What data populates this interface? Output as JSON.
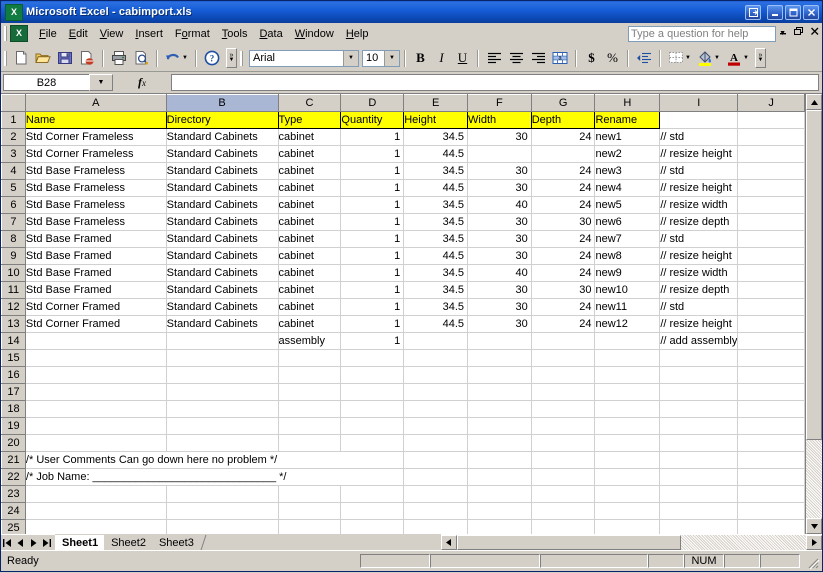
{
  "window": {
    "title": "Microsoft Excel - cabimport.xls",
    "app_icon": "excel-icon",
    "buttons": {
      "restore_group": "restore-window-group",
      "minimize": "minimize",
      "maximize": "maximize",
      "close": "close"
    }
  },
  "menu": {
    "items": [
      {
        "label": "File",
        "accel": "F"
      },
      {
        "label": "Edit",
        "accel": "E"
      },
      {
        "label": "View",
        "accel": "V"
      },
      {
        "label": "Insert",
        "accel": "I"
      },
      {
        "label": "Format",
        "accel": "o"
      },
      {
        "label": "Tools",
        "accel": "T"
      },
      {
        "label": "Data",
        "accel": "D"
      },
      {
        "label": "Window",
        "accel": "W"
      },
      {
        "label": "Help",
        "accel": "H"
      }
    ],
    "ask_box_placeholder": "Type a question for help"
  },
  "toolbar": {
    "buttons": [
      "new-icon",
      "open-icon",
      "save-icon",
      "email-icon",
      "print-icon",
      "print-preview-icon",
      "undo-icon",
      "help-icon"
    ],
    "font_name": "Arial",
    "font_size": "10",
    "bold_label": "B",
    "italic_label": "I",
    "underline_label": "U",
    "align_left": "align-left-icon",
    "align_center": "align-center-icon",
    "align_right": "align-right-icon",
    "merge_center": "merge-and-center-icon",
    "currency_label": "$",
    "percent_label": "%",
    "decrease_indent": "decrease-indent-icon",
    "borders": "borders-icon",
    "fill_color": "fill-color-icon",
    "font_color": "font-color-icon"
  },
  "formula_bar": {
    "name_box": "B28",
    "fx_label": "fx",
    "formula_value": ""
  },
  "grid": {
    "columns": [
      "A",
      "B",
      "C",
      "D",
      "E",
      "F",
      "G",
      "H",
      "I",
      "J"
    ],
    "selected_column": "B",
    "header_row_number": "1",
    "headers": [
      "Name",
      "Directory",
      "Type",
      "Quantity",
      "Height",
      "Width",
      "Depth",
      "Rename",
      "",
      ""
    ],
    "rows": [
      {
        "n": "2",
        "cells": [
          "Std Corner Frameless",
          "Standard Cabinets",
          "cabinet",
          "1",
          "34.5",
          "30",
          "24",
          "new1",
          "// std",
          ""
        ]
      },
      {
        "n": "3",
        "cells": [
          "Std Corner Frameless",
          "Standard Cabinets",
          "cabinet",
          "1",
          "44.5",
          "",
          "",
          "new2",
          "// resize height",
          ""
        ]
      },
      {
        "n": "4",
        "cells": [
          "Std Base Frameless",
          "Standard Cabinets",
          "cabinet",
          "1",
          "34.5",
          "30",
          "24",
          "new3",
          "// std",
          ""
        ]
      },
      {
        "n": "5",
        "cells": [
          "Std Base Frameless",
          "Standard Cabinets",
          "cabinet",
          "1",
          "44.5",
          "30",
          "24",
          "new4",
          "// resize height",
          ""
        ]
      },
      {
        "n": "6",
        "cells": [
          "Std Base Frameless",
          "Standard Cabinets",
          "cabinet",
          "1",
          "34.5",
          "40",
          "24",
          "new5",
          "// resize width",
          ""
        ]
      },
      {
        "n": "7",
        "cells": [
          "Std Base Frameless",
          "Standard Cabinets",
          "cabinet",
          "1",
          "34.5",
          "30",
          "30",
          "new6",
          "// resize depth",
          ""
        ]
      },
      {
        "n": "8",
        "cells": [
          "Std Base Framed",
          "Standard Cabinets",
          "cabinet",
          "1",
          "34.5",
          "30",
          "24",
          "new7",
          "// std",
          ""
        ]
      },
      {
        "n": "9",
        "cells": [
          "Std Base Framed",
          "Standard Cabinets",
          "cabinet",
          "1",
          "44.5",
          "30",
          "24",
          "new8",
          "// resize height",
          ""
        ]
      },
      {
        "n": "10",
        "cells": [
          "Std Base Framed",
          "Standard Cabinets",
          "cabinet",
          "1",
          "34.5",
          "40",
          "24",
          "new9",
          "// resize width",
          ""
        ]
      },
      {
        "n": "11",
        "cells": [
          "Std Base Framed",
          "Standard Cabinets",
          "cabinet",
          "1",
          "34.5",
          "30",
          "30",
          "new10",
          "// resize depth",
          ""
        ]
      },
      {
        "n": "12",
        "cells": [
          "Std Corner Framed",
          "Standard Cabinets",
          "cabinet",
          "1",
          "34.5",
          "30",
          "24",
          "new11",
          "// std",
          ""
        ]
      },
      {
        "n": "13",
        "cells": [
          "Std Corner Framed",
          "Standard Cabinets",
          "cabinet",
          "1",
          "44.5",
          "30",
          "24",
          "new12",
          "// resize height",
          ""
        ]
      },
      {
        "n": "14",
        "cells": [
          "",
          "",
          "assembly",
          "1",
          "",
          "",
          "",
          "",
          "// add assembly",
          ""
        ]
      },
      {
        "n": "15",
        "cells": [
          "",
          "",
          "",
          "",
          "",
          "",
          "",
          "",
          "",
          ""
        ]
      },
      {
        "n": "16",
        "cells": [
          "",
          "",
          "",
          "",
          "",
          "",
          "",
          "",
          "",
          ""
        ]
      },
      {
        "n": "17",
        "cells": [
          "",
          "",
          "",
          "",
          "",
          "",
          "",
          "",
          "",
          ""
        ]
      },
      {
        "n": "18",
        "cells": [
          "",
          "",
          "",
          "",
          "",
          "",
          "",
          "",
          "",
          ""
        ]
      },
      {
        "n": "19",
        "cells": [
          "",
          "",
          "",
          "",
          "",
          "",
          "",
          "",
          "",
          ""
        ]
      },
      {
        "n": "20",
        "cells": [
          "",
          "",
          "",
          "",
          "",
          "",
          "",
          "",
          "",
          ""
        ]
      },
      {
        "n": "21",
        "cells": [
          "/*  User Comments Can go down here no problem  */",
          "",
          "",
          "",
          "",
          "",
          "",
          "",
          "",
          ""
        ],
        "span": true
      },
      {
        "n": "22",
        "cells": [
          "/*   Job Name: ______________________________       */",
          "",
          "",
          "",
          "",
          "",
          "",
          "",
          "",
          ""
        ],
        "span": true
      },
      {
        "n": "23",
        "cells": [
          "",
          "",
          "",
          "",
          "",
          "",
          "",
          "",
          "",
          ""
        ]
      },
      {
        "n": "24",
        "cells": [
          "",
          "",
          "",
          "",
          "",
          "",
          "",
          "",
          "",
          ""
        ]
      },
      {
        "n": "25",
        "cells": [
          "",
          "",
          "",
          "",
          "",
          "",
          "",
          "",
          "",
          ""
        ]
      }
    ],
    "header_fill_color": "#ffff00"
  },
  "sheet_tabs": {
    "nav": [
      "first-sheet",
      "prev-sheet",
      "next-sheet",
      "last-sheet"
    ],
    "tabs": [
      {
        "label": "Sheet1",
        "active": true
      },
      {
        "label": "Sheet2",
        "active": false
      },
      {
        "label": "Sheet3",
        "active": false
      }
    ]
  },
  "status_bar": {
    "message": "Ready",
    "indicators": [
      "",
      "",
      "",
      "",
      "NUM",
      "",
      ""
    ],
    "num_lock": "NUM"
  }
}
